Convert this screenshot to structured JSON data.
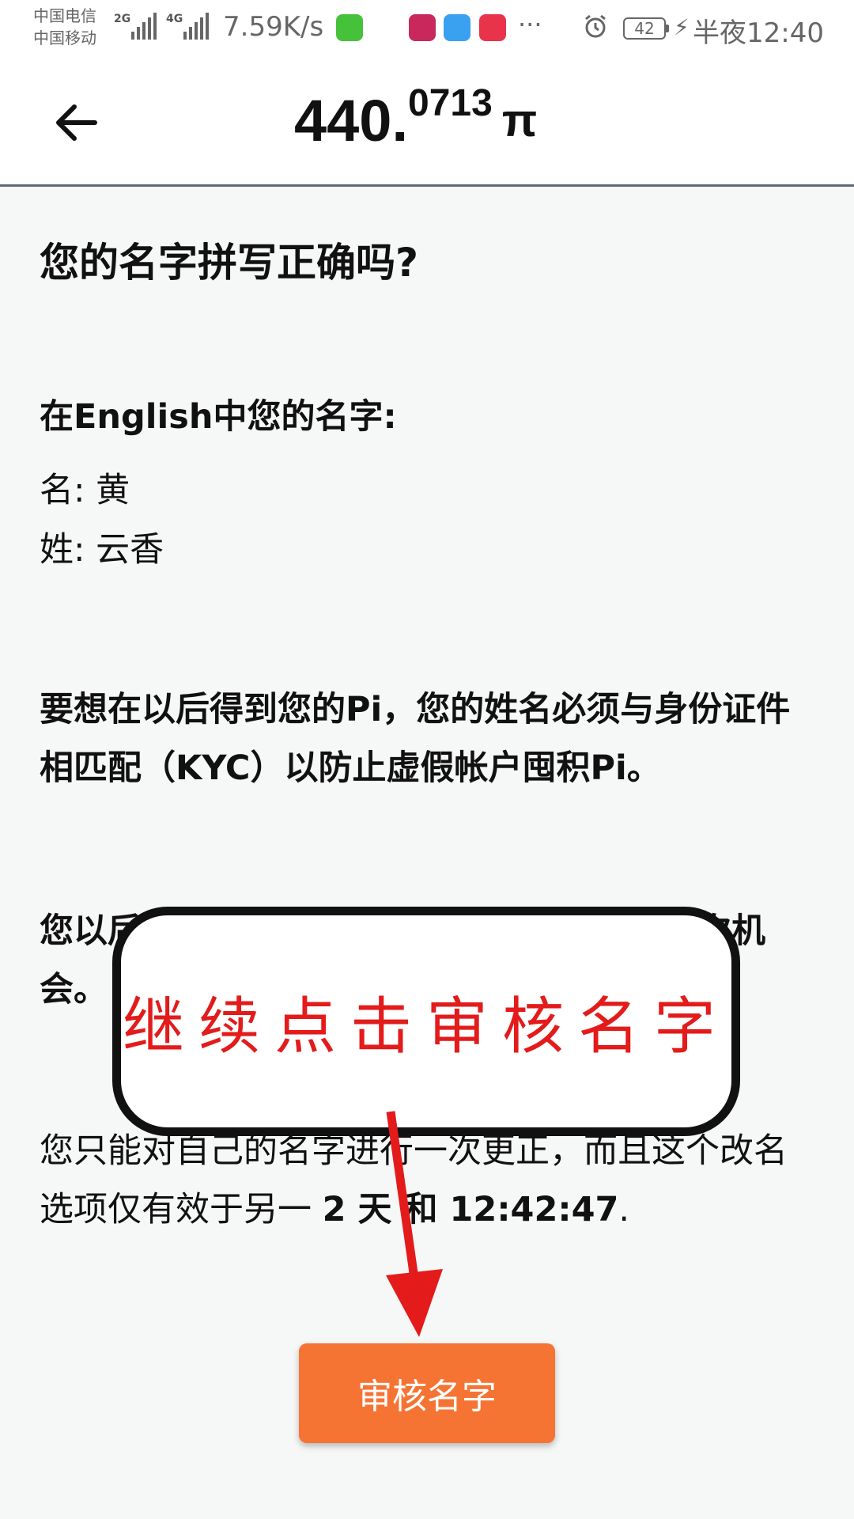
{
  "status_bar": {
    "carrier_1": "中国电信",
    "carrier_2": "中国移动",
    "net_1": "2G",
    "net_2": "4G",
    "speed": "7.59K/s",
    "battery": "42",
    "time": "半夜12:40",
    "more": "···",
    "icons": [
      "signal-icon",
      "wechat-app-icon",
      "lotus-app-icon",
      "dingtalk-app-icon",
      "huawei-appgallery-icon",
      "alarm-icon",
      "battery-icon",
      "charging-icon"
    ]
  },
  "header": {
    "balance_integer": "440.",
    "balance_decimal": "0713",
    "currency_symbol": "π",
    "back_icon": "back-arrow-icon"
  },
  "content": {
    "question": "您的名字拼写正确吗?",
    "english_label": "在English中您的名字:",
    "first_name": "名: 黄",
    "last_name": "姓: 云香",
    "kyc_notice": "要想在以后得到您的Pi，您的姓名必须与身份证件相匹配（KYC）以防止虚假帐户囤积Pi。",
    "last_chance": "您以后将不能更改自己的名字。 这是最后一次机会。",
    "once_prefix": "您只能对自己的名字进行一次更正，而且这个改名选项仅有效于另一 ",
    "once_time": "2 天 和 12:42:47",
    "once_suffix": "."
  },
  "annotation": {
    "text": "继续点击审核名字"
  },
  "button": {
    "label": "审核名字"
  },
  "colors": {
    "accent": "#f57433",
    "annotation_red": "#e31b1b",
    "background": "#f6f7f7"
  }
}
